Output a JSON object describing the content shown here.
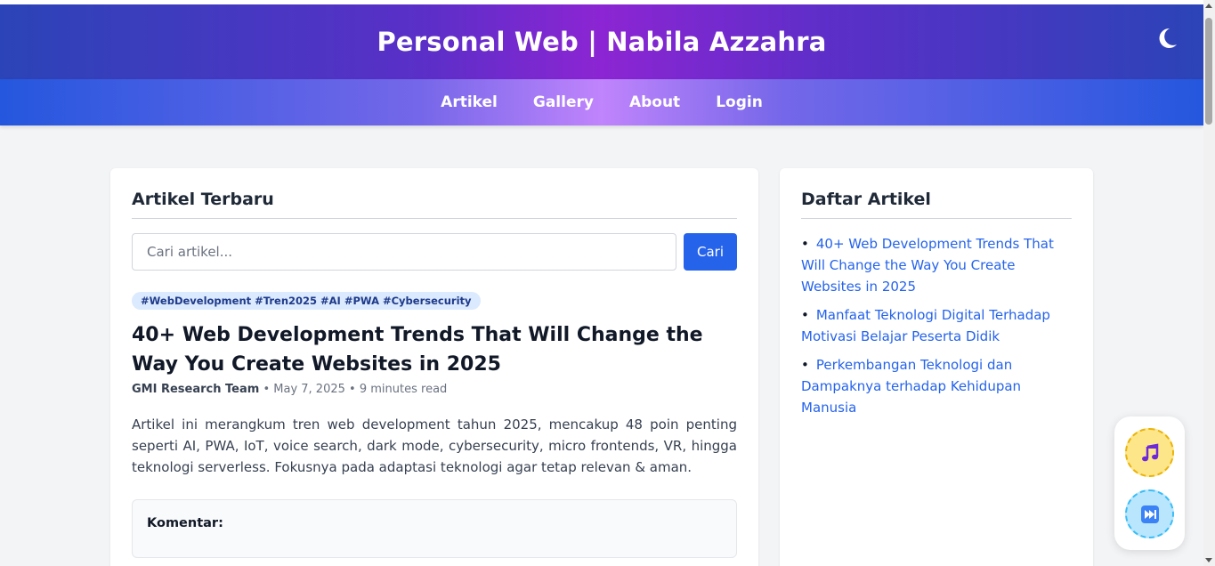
{
  "header": {
    "title": "Personal Web | Nabila Azzahra",
    "theme_icon": "moon-icon"
  },
  "nav": {
    "items": [
      {
        "label": "Artikel"
      },
      {
        "label": "Gallery"
      },
      {
        "label": "About"
      },
      {
        "label": "Login"
      }
    ]
  },
  "main": {
    "section_title": "Artikel Terbaru",
    "search": {
      "placeholder": "Cari artikel...",
      "value": "",
      "button_label": "Cari"
    },
    "article": {
      "tags": "#WebDevelopment #Tren2025 #AI #PWA #Cybersecurity",
      "title": "40+ Web Development Trends That Will Change the Way You Create Websites in 2025",
      "author": "GMI Research Team",
      "separator": "•",
      "date": "May 7, 2025",
      "read_time": "9 minutes read",
      "excerpt": "Artikel ini merangkum tren web development tahun 2025, mencakup 48 poin penting seperti AI, PWA, IoT, voice search, dark mode, cybersecurity, micro frontends, VR, hingga teknologi serverless. Fokusnya pada adaptasi teknologi agar tetap relevan & aman.",
      "comment_label": "Komentar:"
    }
  },
  "sidebar": {
    "title": "Daftar Artikel",
    "bullet": "•",
    "items": [
      {
        "label": "40+ Web Development Trends That Will Change the Way You Create Websites in 2025"
      },
      {
        "label": "Manfaat Teknologi Digital Terhadap Motivasi Belajar Peserta Didik"
      },
      {
        "label": "Perkembangan Teknologi dan Dampaknya terhadap Kehidupan Manusia"
      }
    ]
  },
  "music_player": {
    "play_icon": "music-note-icon",
    "next_icon": "next-track-icon"
  },
  "colors": {
    "accent": "#2563eb",
    "header_gradient_mid": "#8c25d3",
    "nav_gradient_mid": "#c084fc"
  }
}
